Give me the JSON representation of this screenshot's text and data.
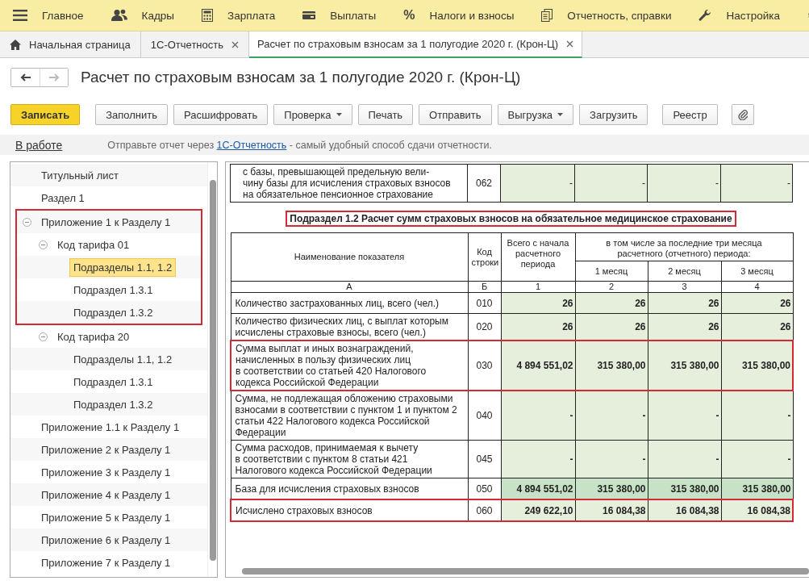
{
  "menu": [
    {
      "label": "Главное"
    },
    {
      "label": "Кадры"
    },
    {
      "label": "Зарплата"
    },
    {
      "label": "Выплаты"
    },
    {
      "label": "Налоги и взносы",
      "glyph": "%"
    },
    {
      "label": "Отчетность, справки"
    },
    {
      "label": "Настройка"
    }
  ],
  "tabs": [
    {
      "label": "Начальная страница",
      "kind": "home",
      "selected": false
    },
    {
      "label": "1С-Отчетность",
      "kind": "closable",
      "selected": false
    },
    {
      "label": "Расчет по страховым взносам за 1 полугодие 2020 г. (Крон-Ц)",
      "kind": "closable",
      "selected": true
    }
  ],
  "form": {
    "title": "Расчет по страховым взносам за 1 полугодие 2020 г. (Крон-Ц)"
  },
  "toolbar": [
    {
      "label": "Записать",
      "kind": "primary"
    },
    {
      "label": "Заполнить",
      "kind": "plain"
    },
    {
      "label": "Расшифровать",
      "kind": "plain"
    },
    {
      "label": "Проверка",
      "kind": "dropdown"
    },
    {
      "label": "Печать",
      "kind": "plain"
    },
    {
      "label": "Отправить",
      "kind": "plain"
    },
    {
      "label": "Выгрузка",
      "kind": "dropdown"
    },
    {
      "label": "Загрузить",
      "kind": "plain"
    },
    {
      "label": "Реестр",
      "kind": "plain"
    },
    {
      "kind": "attach"
    }
  ],
  "info": {
    "status": "В работе",
    "before": "Отправьте отчет через ",
    "link": "1С-Отчетность",
    "after": " - самый удобный способ сдачи отчетности."
  },
  "tree": {
    "items": [
      {
        "label": "Титульный лист",
        "selected": false
      },
      {
        "label": "Раздел 1",
        "selected": false
      },
      {
        "label": "Приложение 1 к Разделу 1",
        "selected": false,
        "highlighted": true,
        "expanded": true,
        "children": [
          {
            "label": "Код тарифа 01",
            "selected": false,
            "highlighted": true,
            "expanded": true,
            "children": [
              {
                "label": "Подразделы 1.1, 1.2",
                "selected": true,
                "highlighted": true
              },
              {
                "label": "Подраздел 1.3.1",
                "selected": false,
                "highlighted": true
              },
              {
                "label": "Подраздел 1.3.2",
                "selected": false,
                "highlighted": true
              }
            ]
          },
          {
            "label": "Код тарифа 20",
            "selected": false,
            "expanded": true,
            "children": [
              {
                "label": "Подразделы 1.1, 1.2",
                "selected": false
              },
              {
                "label": "Подраздел 1.3.1",
                "selected": false
              },
              {
                "label": "Подраздел 1.3.2",
                "selected": false
              }
            ]
          }
        ]
      },
      {
        "label": "Приложение 1.1 к Разделу 1",
        "selected": false
      },
      {
        "label": "Приложение 2 к Разделу 1",
        "selected": false
      },
      {
        "label": "Приложение 3 к Разделу 1",
        "selected": false
      },
      {
        "label": "Приложение 4 к Разделу 1",
        "selected": false
      },
      {
        "label": "Приложение 5 к Разделу 1",
        "selected": false
      },
      {
        "label": "Приложение 6 к Разделу 1",
        "selected": false
      },
      {
        "label": "Приложение 7 к Разделу 1",
        "selected": false
      }
    ]
  },
  "report": {
    "previous_row": {
      "name": "с базы, превышающей предельную вели-\nчину базы для исчисления страховых взносов\nна обязательное пенсионное страхование",
      "code": "062",
      "values": [
        "-",
        "-",
        "-",
        "-"
      ]
    },
    "section": {
      "title": "Подраздел 1.2 Расчет сумм страховых взносов на обязательное медицинское страхование",
      "highlighted": true
    },
    "headers": {
      "name": "Наименование показателя",
      "code": "Код\nстроки",
      "total": "Всего с начала\nрасчетного\nпериода",
      "months_group": "в том числе за последние три месяца\nрасчетного (отчетного) периода:",
      "months": [
        "1 месяц",
        "2 месяц",
        "3 месяц"
      ],
      "letters": [
        "А",
        "Б",
        "1",
        "2",
        "3",
        "4"
      ]
    },
    "rows": [
      {
        "name": "Количество застрахованных лиц, всего (чел.)",
        "code": "010",
        "values": [
          "26",
          "26",
          "26",
          "26"
        ],
        "highlighted": false,
        "total": false
      },
      {
        "name": "Количество физических лиц, с выплат которым\nисчислены страховые взносы, всего (чел.)",
        "code": "020",
        "values": [
          "26",
          "26",
          "26",
          "26"
        ],
        "highlighted": false,
        "total": false
      },
      {
        "name": "Сумма выплат и иных вознаграждений,\nначисленных в пользу физических лиц\nв соответствии со статьей 420 Налогового\nкодекса Российской Федерации",
        "code": "030",
        "values": [
          "4 894 551,02",
          "315 380,00",
          "315 380,00",
          "315 380,00"
        ],
        "highlighted": true,
        "total": false
      },
      {
        "name": "Сумма, не подлежащая обложению страховыми\nвзносами в соответствии с пунктом 1 и пунктом 2\nстатьи 422 Налогового кодекса Российской\nФедерации",
        "code": "040",
        "values": [
          "-",
          "-",
          "-",
          "-"
        ],
        "highlighted": false,
        "total": false
      },
      {
        "name": "Сумма расходов, принимаемая к вычету\nв соответствии с пунктом 8 статьи 421\nНалогового кодекса Российской Федерации",
        "code": "045",
        "values": [
          "-",
          "-",
          "-",
          "-"
        ],
        "highlighted": false,
        "total": false
      },
      {
        "name": "База для исчисления страховых взносов",
        "code": "050",
        "values": [
          "4 894 551,02",
          "315 380,00",
          "315 380,00",
          "315 380,00"
        ],
        "highlighted": false,
        "total": true
      },
      {
        "name": "Исчислено страховых взносов",
        "code": "060",
        "values": [
          "249 622,10",
          "16 084,38",
          "16 084,38",
          "16 084,38"
        ],
        "highlighted": true,
        "total": false
      }
    ]
  }
}
